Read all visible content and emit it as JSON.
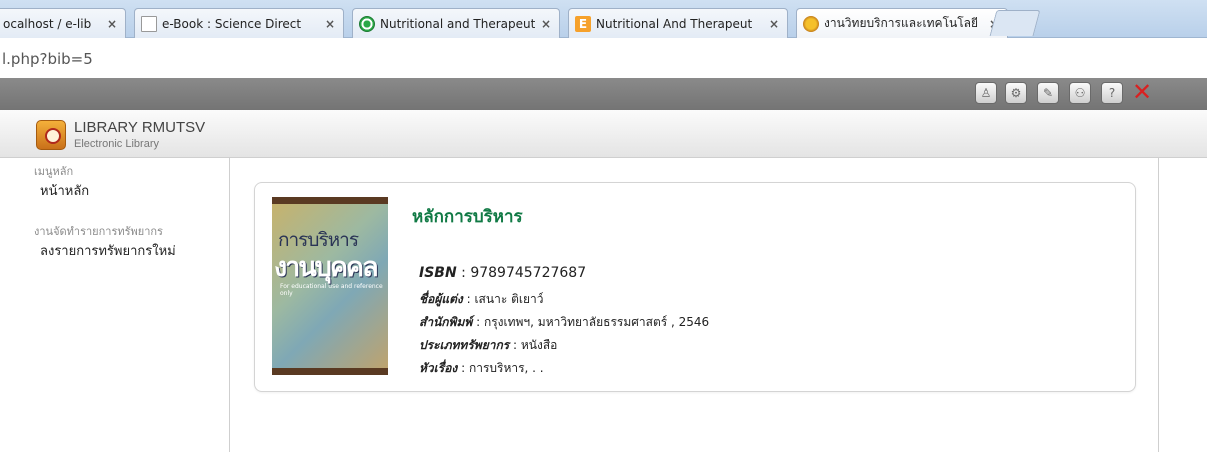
{
  "browser": {
    "tabs": [
      {
        "label": "ocalhost / e-lib",
        "close": "×",
        "icon": "none"
      },
      {
        "label": "e-Book : Science Direct",
        "close": "×",
        "icon": "page-icon"
      },
      {
        "label": "Nutritional and Therapeut",
        "close": "×",
        "icon": "green-circle-icon"
      },
      {
        "label": "Nutritional And Therapeut",
        "close": "×",
        "icon": "e-icon"
      },
      {
        "label": "งานวิทยบริการและเทคโนโลยี",
        "close": "×",
        "icon": "bee-icon"
      }
    ],
    "e_icon_letter": "E",
    "address": "l.php?bib=5"
  },
  "toolbar": {
    "buttons": [
      {
        "name": "user",
        "glyph": "♙"
      },
      {
        "name": "settings",
        "glyph": "⚙"
      },
      {
        "name": "edit",
        "glyph": "✎"
      },
      {
        "name": "users",
        "glyph": "⚇"
      },
      {
        "name": "help",
        "glyph": "?"
      }
    ],
    "close_glyph": "✕",
    "close_color": "#d92121"
  },
  "brand": {
    "title": "LIBRARY RMUTSV",
    "subtitle": "Electronic Library"
  },
  "sidebar": {
    "sections": [
      {
        "heading": "เมนูหลัก",
        "items": [
          "หน้าหลัก"
        ]
      },
      {
        "heading": "งานจัดทำรายการทรัพยากร",
        "items": [
          "ลงรายการทรัพยากรใหม่"
        ]
      }
    ]
  },
  "book": {
    "title": "หลักการบริหาร",
    "title_color": "#117a45",
    "cover_title_1": "การบริหาร",
    "cover_title_2": "งานบุคคล",
    "cover_subtitle": "For educational use and reference only",
    "fields": [
      {
        "key": "ISBN",
        "value": "9789745727687"
      },
      {
        "key": "ชื่อผู้แต่ง",
        "value": "เสนาะ ติเยาว์"
      },
      {
        "key": "สำนักพิมพ์",
        "value": "กรุงเทพฯ, มหาวิทยาลัยธรรมศาสตร์ , 2546"
      },
      {
        "key": "ประเภททรัพยากร",
        "value": "หนังสือ"
      },
      {
        "key": "หัวเรื่อง",
        "value": "การบริหาร, . ."
      }
    ],
    "separator": " : "
  }
}
